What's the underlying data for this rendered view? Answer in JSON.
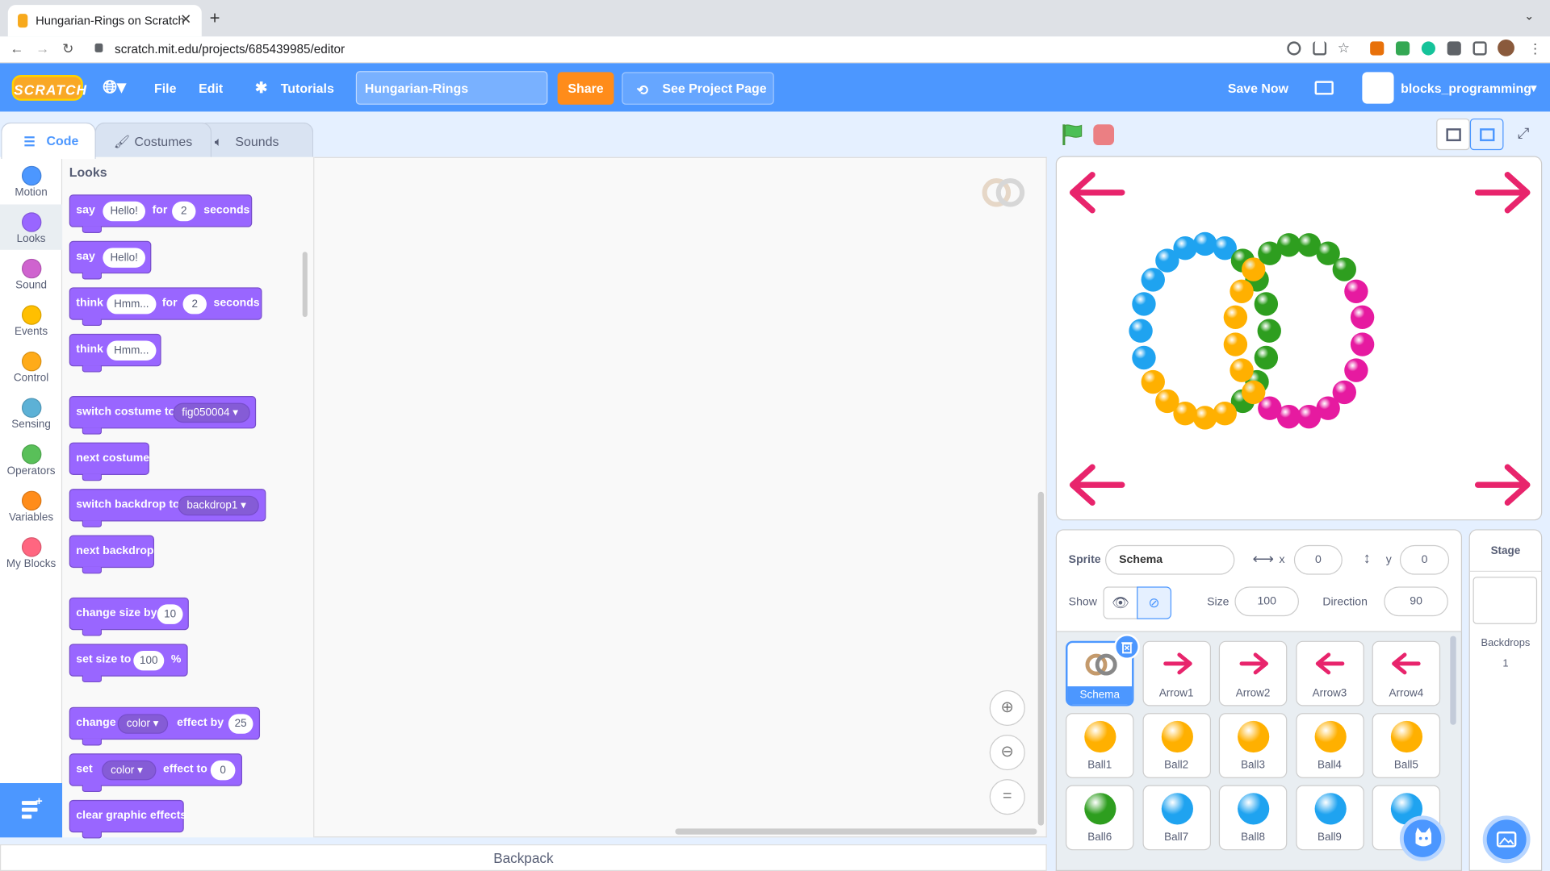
{
  "browser": {
    "tab_title": "Hungarian-Rings on Scratch",
    "new_tab": "+",
    "url": "scratch.mit.edu/projects/685439985/editor"
  },
  "menu": {
    "logo": "SCRATCH",
    "file": "File",
    "edit": "Edit",
    "tutorials": "Tutorials",
    "project_title": "Hungarian-Rings",
    "share": "Share",
    "see_project_page": "See Project Page",
    "save_now": "Save Now",
    "username": "blocks_programming"
  },
  "editor_tabs": {
    "code": "Code",
    "costumes": "Costumes",
    "sounds": "Sounds"
  },
  "categories": [
    {
      "label": "Motion",
      "color": "#4c97ff"
    },
    {
      "label": "Looks",
      "color": "#9966ff"
    },
    {
      "label": "Sound",
      "color": "#cf63cf"
    },
    {
      "label": "Events",
      "color": "#ffbf00"
    },
    {
      "label": "Control",
      "color": "#ffab19"
    },
    {
      "label": "Sensing",
      "color": "#5cb1d6"
    },
    {
      "label": "Operators",
      "color": "#59c059"
    },
    {
      "label": "Variables",
      "color": "#ff8c1a"
    },
    {
      "label": "My Blocks",
      "color": "#ff6680"
    }
  ],
  "palette": {
    "title": "Looks",
    "blocks": {
      "say_for": {
        "a": "say",
        "msg": "Hello!",
        "b": "for",
        "secs": "2",
        "c": "seconds"
      },
      "say": {
        "a": "say",
        "msg": "Hello!"
      },
      "think_for": {
        "a": "think",
        "msg": "Hmm...",
        "b": "for",
        "secs": "2",
        "c": "seconds"
      },
      "think": {
        "a": "think",
        "msg": "Hmm..."
      },
      "switch_costume": {
        "a": "switch costume to",
        "val": "fig050004"
      },
      "next_costume": {
        "a": "next costume"
      },
      "switch_backdrop": {
        "a": "switch backdrop to",
        "val": "backdrop1"
      },
      "next_backdrop": {
        "a": "next backdrop"
      },
      "change_size": {
        "a": "change size by",
        "val": "10"
      },
      "set_size": {
        "a": "set size to",
        "val": "100",
        "b": "%"
      },
      "change_effect": {
        "a": "change",
        "effect": "color",
        "b": "effect by",
        "val": "25"
      },
      "set_effect": {
        "a": "set",
        "effect": "color",
        "b": "effect to",
        "val": "0"
      },
      "clear_effects": {
        "a": "clear graphic effects"
      }
    }
  },
  "backpack": "Backpack",
  "sprite_info": {
    "sprite_label": "Sprite",
    "sprite_name": "Schema",
    "x_label": "x",
    "x": "0",
    "y_label": "y",
    "y": "0",
    "show_label": "Show",
    "size_label": "Size",
    "size": "100",
    "direction_label": "Direction",
    "direction": "90"
  },
  "sprites": [
    {
      "name": "Schema",
      "kind": "schema"
    },
    {
      "name": "Arrow1",
      "kind": "arrow-right"
    },
    {
      "name": "Arrow2",
      "kind": "arrow-right"
    },
    {
      "name": "Arrow3",
      "kind": "arrow-left"
    },
    {
      "name": "Arrow4",
      "kind": "arrow-left"
    },
    {
      "name": "Ball1",
      "color": "#ffb000"
    },
    {
      "name": "Ball2",
      "color": "#ffb000"
    },
    {
      "name": "Ball3",
      "color": "#ffb000"
    },
    {
      "name": "Ball4",
      "color": "#ffb000"
    },
    {
      "name": "Ball5",
      "color": "#ffb000"
    },
    {
      "name": "Ball6",
      "color": "#2e9e1f"
    },
    {
      "name": "Ball7",
      "color": "#1fa3f0"
    },
    {
      "name": "Ball8",
      "color": "#1fa3f0"
    },
    {
      "name": "Ball9",
      "color": "#1fa3f0"
    },
    {
      "name": "Ba",
      "color": "#1fa3f0"
    }
  ],
  "stage_panel": {
    "title": "Stage",
    "backdrops_label": "Backdrops",
    "backdrops_count": "1"
  },
  "colors": {
    "blue_ring": "#1fa3f0",
    "green_ring": "#2e9e1f",
    "yellow_ring": "#ffb000",
    "pink_ring": "#e61aa0",
    "arrows": "#e8246c"
  }
}
